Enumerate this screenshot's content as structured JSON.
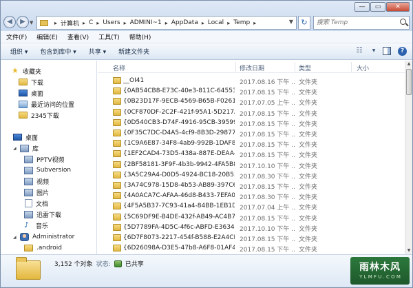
{
  "window": {
    "caption_minimize": "—",
    "caption_maximize": "▭",
    "caption_close": "✕"
  },
  "address_bar": {
    "segments": [
      "计算机",
      "C",
      "Users",
      "ADMINI~1",
      "AppData",
      "Local",
      "Temp"
    ],
    "search_placeholder": "搜索 Temp"
  },
  "menu": [
    "文件(F)",
    "编辑(E)",
    "查看(V)",
    "工具(T)",
    "帮助(H)"
  ],
  "toolbar": {
    "organize": "组织 ▾",
    "include_in_library": "包含到库中 ▾",
    "share": "共享 ▾",
    "new_folder": "新建文件夹"
  },
  "nav_pane": {
    "favorites": "收藏夹",
    "downloads": "下载",
    "desktop_fav": "桌面",
    "recent": "最近访问的位置",
    "downloads_2345": "2345下载",
    "desktop": "桌面",
    "libraries": "库",
    "lib_items": [
      "PPTV视频",
      "Subversion",
      "视频",
      "图片",
      "文档",
      "迅雷下载",
      "音乐"
    ],
    "administrator": "Administrator",
    "android": ".android"
  },
  "columns": {
    "name": "名称",
    "date": "修改日期",
    "type": "类型",
    "size": "大小"
  },
  "files": [
    {
      "name": "__OI41",
      "date": "2017.08.16 下午 ...",
      "type": "文件夹"
    },
    {
      "name": "{0AB54CB8-E73C-40e3-811C-645539...",
      "date": "2017.08.15 下午 ...",
      "type": "文件夹"
    },
    {
      "name": "{0B23D17F-9ECB-4569-B65B-F0261A...",
      "date": "2017.07.05 上午 ...",
      "type": "文件夹"
    },
    {
      "name": "{0CF870DF-2C2F-421f-95A1-5D217AA...",
      "date": "2017.08.15 下午 ...",
      "type": "文件夹"
    },
    {
      "name": "{0D540CB3-D74F-4916-95CB-39599B...",
      "date": "2017.08.15 下午 ...",
      "type": "文件夹"
    },
    {
      "name": "{0F35C7DC-D4A5-4cf9-8B3D-29877E...",
      "date": "2017.08.15 下午 ...",
      "type": "文件夹"
    },
    {
      "name": "{1C9A6E87-34F8-4ab9-992B-1DAF89...",
      "date": "2017.08.15 下午 ...",
      "type": "文件夹"
    },
    {
      "name": "{1EF2CAD4-73D5-438a-887E-DEAA4B...",
      "date": "2017.08.15 下午 ...",
      "type": "文件夹"
    },
    {
      "name": "{2BF58181-3F9F-4b3b-9942-4FA5B82...",
      "date": "2017.10.10 下午 ...",
      "type": "文件夹"
    },
    {
      "name": "{3A5C29A4-D0D5-4924-BC18-20B53A...",
      "date": "2017.08.30 下午 ...",
      "type": "文件夹"
    },
    {
      "name": "{3A74C978-15D8-4b53-AB89-397C6D...",
      "date": "2017.08.15 下午 ...",
      "type": "文件夹"
    },
    {
      "name": "{4A0ACA7C-AFAA-46d8-B433-7EFA0E...",
      "date": "2017.08.30 下午 ...",
      "type": "文件夹"
    },
    {
      "name": "{4F5A5B37-7C93-41a4-84BB-1EB1D3...",
      "date": "2017.07.04 上午 ...",
      "type": "文件夹"
    },
    {
      "name": "{5C69DF9E-B4DE-432f-AB49-AC4B7C...",
      "date": "2017.08.15 下午 ...",
      "type": "文件夹"
    },
    {
      "name": "{5D7789FA-4D5C-4f6c-ABFD-E363486...",
      "date": "2017.10.10 下午 ...",
      "type": "文件夹"
    },
    {
      "name": "{6D7F8073-2217-454f-B588-E2A4CB1...",
      "date": "2017.08.15 下午 ...",
      "type": "文件夹"
    },
    {
      "name": "{6D26098A-D3E5-47b8-A6F8-01AF4B...",
      "date": "2017.08.15 下午 ...",
      "type": "文件夹"
    },
    {
      "name": "{6F8A0CF6-074F-46e9-8D5F-82560E2...",
      "date": "2017.08.15 下午 ...",
      "type": "文件夹"
    }
  ],
  "details": {
    "count": "3,152 个对象",
    "state_label": "状态:",
    "state_value": "已共享"
  },
  "watermark": {
    "top": "雨林木风",
    "bottom": "Y L M F U . C O M"
  }
}
